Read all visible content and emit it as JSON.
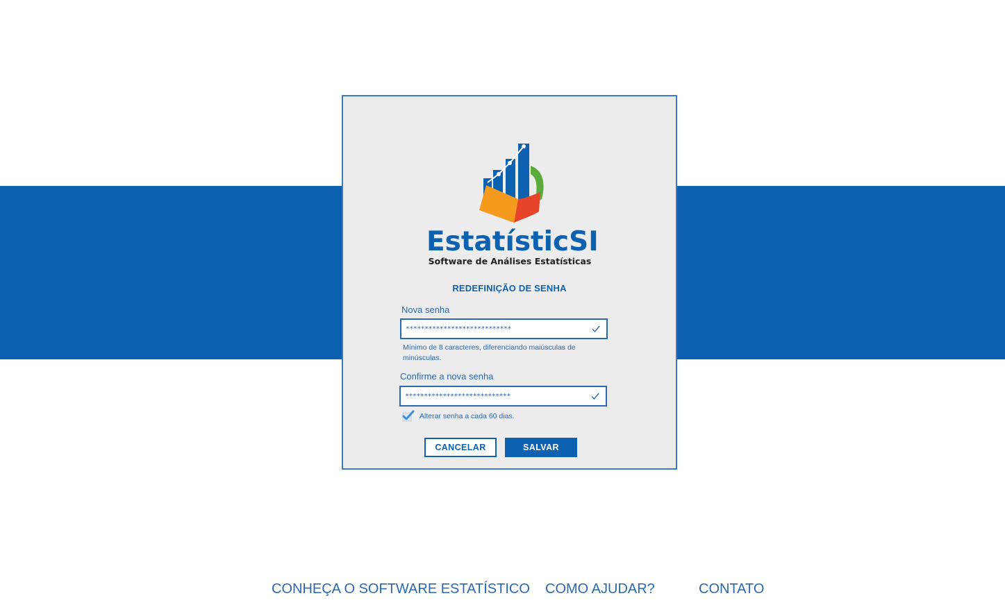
{
  "brand": {
    "name": "EstatísticSI",
    "tagline": "Software de Análises Estatísticas",
    "colors": {
      "primary": "#0d61b1",
      "card_background": "#ececec",
      "logo_orange": "#f59a1c",
      "logo_red": "#e8442a",
      "logo_green": "#5aab3c"
    }
  },
  "form": {
    "title": "REDEFINIÇÃO DE SENHA",
    "new_password": {
      "label": "Nova senha",
      "value": "****************************",
      "valid_icon": "check-icon"
    },
    "hint": "Mínimo de 8 caracteres, diferenciando maiúsculas de minúsculas.",
    "confirm_password": {
      "label": "Confirme a nova senha",
      "value": "****************************",
      "valid_icon": "check-icon"
    },
    "rotate_option": {
      "label": "Alterar senha a cada 60 dias.",
      "checked": true
    },
    "buttons": {
      "cancel": "CANCELAR",
      "save": "SALVAR"
    }
  },
  "footer": {
    "links": [
      "CONHEÇA O SOFTWARE ESTATÍSTICO",
      "COMO AJUDAR?",
      "CONTATO"
    ]
  }
}
